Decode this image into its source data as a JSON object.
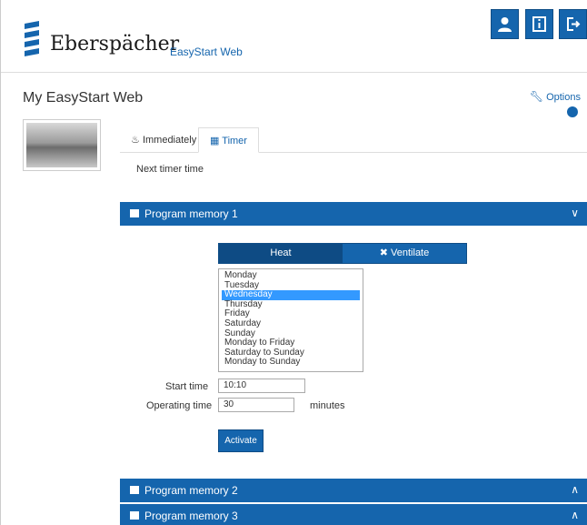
{
  "header": {
    "logo_text": "Eberspächer",
    "app_name": "EasyStart Web",
    "buttons": [
      {
        "icon": "user-icon"
      },
      {
        "icon": "info-icon"
      },
      {
        "icon": "logout-icon"
      }
    ],
    "accent_color": "#1565ad"
  },
  "page": {
    "title": "My EasyStart Web",
    "options_label": "Options"
  },
  "tabs": [
    {
      "label": "Immediately",
      "icon": "flame-icon"
    },
    {
      "label": "Timer",
      "icon": "calendar-icon",
      "active": true
    }
  ],
  "next_timer_label": "Next timer time",
  "panels": [
    {
      "label": "Program memory 1",
      "expanded": true
    },
    {
      "label": "Program memory 2",
      "expanded": false
    },
    {
      "label": "Program memory 3",
      "expanded": false
    }
  ],
  "mode": {
    "heat_label": "Heat",
    "ventilate_label": "Ventilate",
    "selected": "Heat"
  },
  "days": {
    "options": [
      "Monday",
      "Tuesday",
      "Wednesday",
      "Thursday",
      "Friday",
      "Saturday",
      "Sunday",
      "Monday to Friday",
      "Saturday to Sunday",
      "Monday to Sunday"
    ],
    "selected": "Wednesday"
  },
  "form": {
    "start_time_label": "Start time",
    "start_time_value": "10:10",
    "operating_time_label": "Operating time",
    "operating_time_value": "30",
    "minutes_label": "minutes",
    "activate_label": "Activate"
  }
}
